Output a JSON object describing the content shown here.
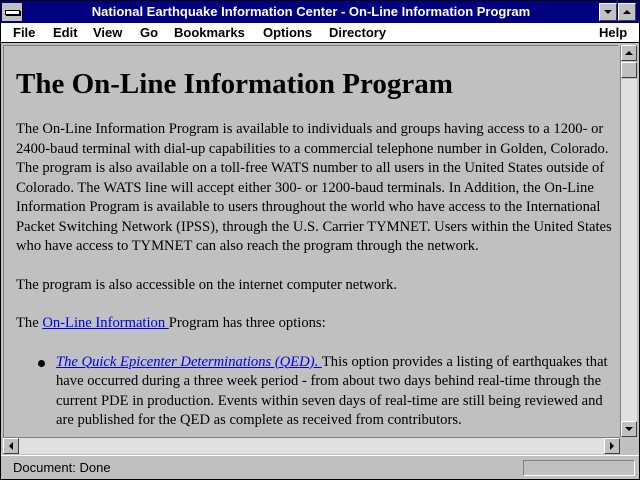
{
  "window": {
    "title": "National Earthquake Information Center - On-Line Information Program"
  },
  "menu": {
    "items": [
      "File",
      "Edit",
      "View",
      "Go",
      "Bookmarks",
      "Options",
      "Directory",
      "Help"
    ]
  },
  "page": {
    "heading": "The On-Line Information Program",
    "para1": "The On-Line Information Program is available to individuals and groups having access to a 1200- or 2400-baud terminal with dial-up capabilities to a commercial telephone number in Golden, Colorado. The program is also available on a toll-free WATS number to all users in the United States outside of Colorado. The WATS line will accept either 300- or 1200-baud terminals. In Addition, the On-Line Information Program is available to users throughout the world who have access to the International Packet Switching Network (IPSS), through the U.S. Carrier TYMNET. Users within the United States who have access to TYMNET can also reach the program through the network.",
    "para2": "The program is also accessible on the internet computer network.",
    "para3_prefix": "The ",
    "para3_link": "On-Line Information ",
    "para3_suffix": "Program has three options:",
    "bullets": [
      {
        "link": "The Quick Epicenter Determinations (QED). ",
        "text": "This option provides a listing of earthquakes that have occurred during a three week period - from about two days behind real-time through the current PDE in production. Events within seven days of real-time are still being reviewed and are published for the QED as complete as received from contributors."
      }
    ]
  },
  "status": {
    "text": "Document: Done"
  },
  "icons": {
    "system_menu": "system-menu-icon",
    "minimize": "minimize-icon",
    "maximize": "maximize-icon",
    "scroll_up": "arrow-up-icon",
    "scroll_down": "arrow-down-icon",
    "scroll_left": "arrow-left-icon",
    "scroll_right": "arrow-right-icon"
  },
  "colors": {
    "titlebar": "#000080",
    "link": "#0000ee",
    "background": "#c0c0c0"
  }
}
